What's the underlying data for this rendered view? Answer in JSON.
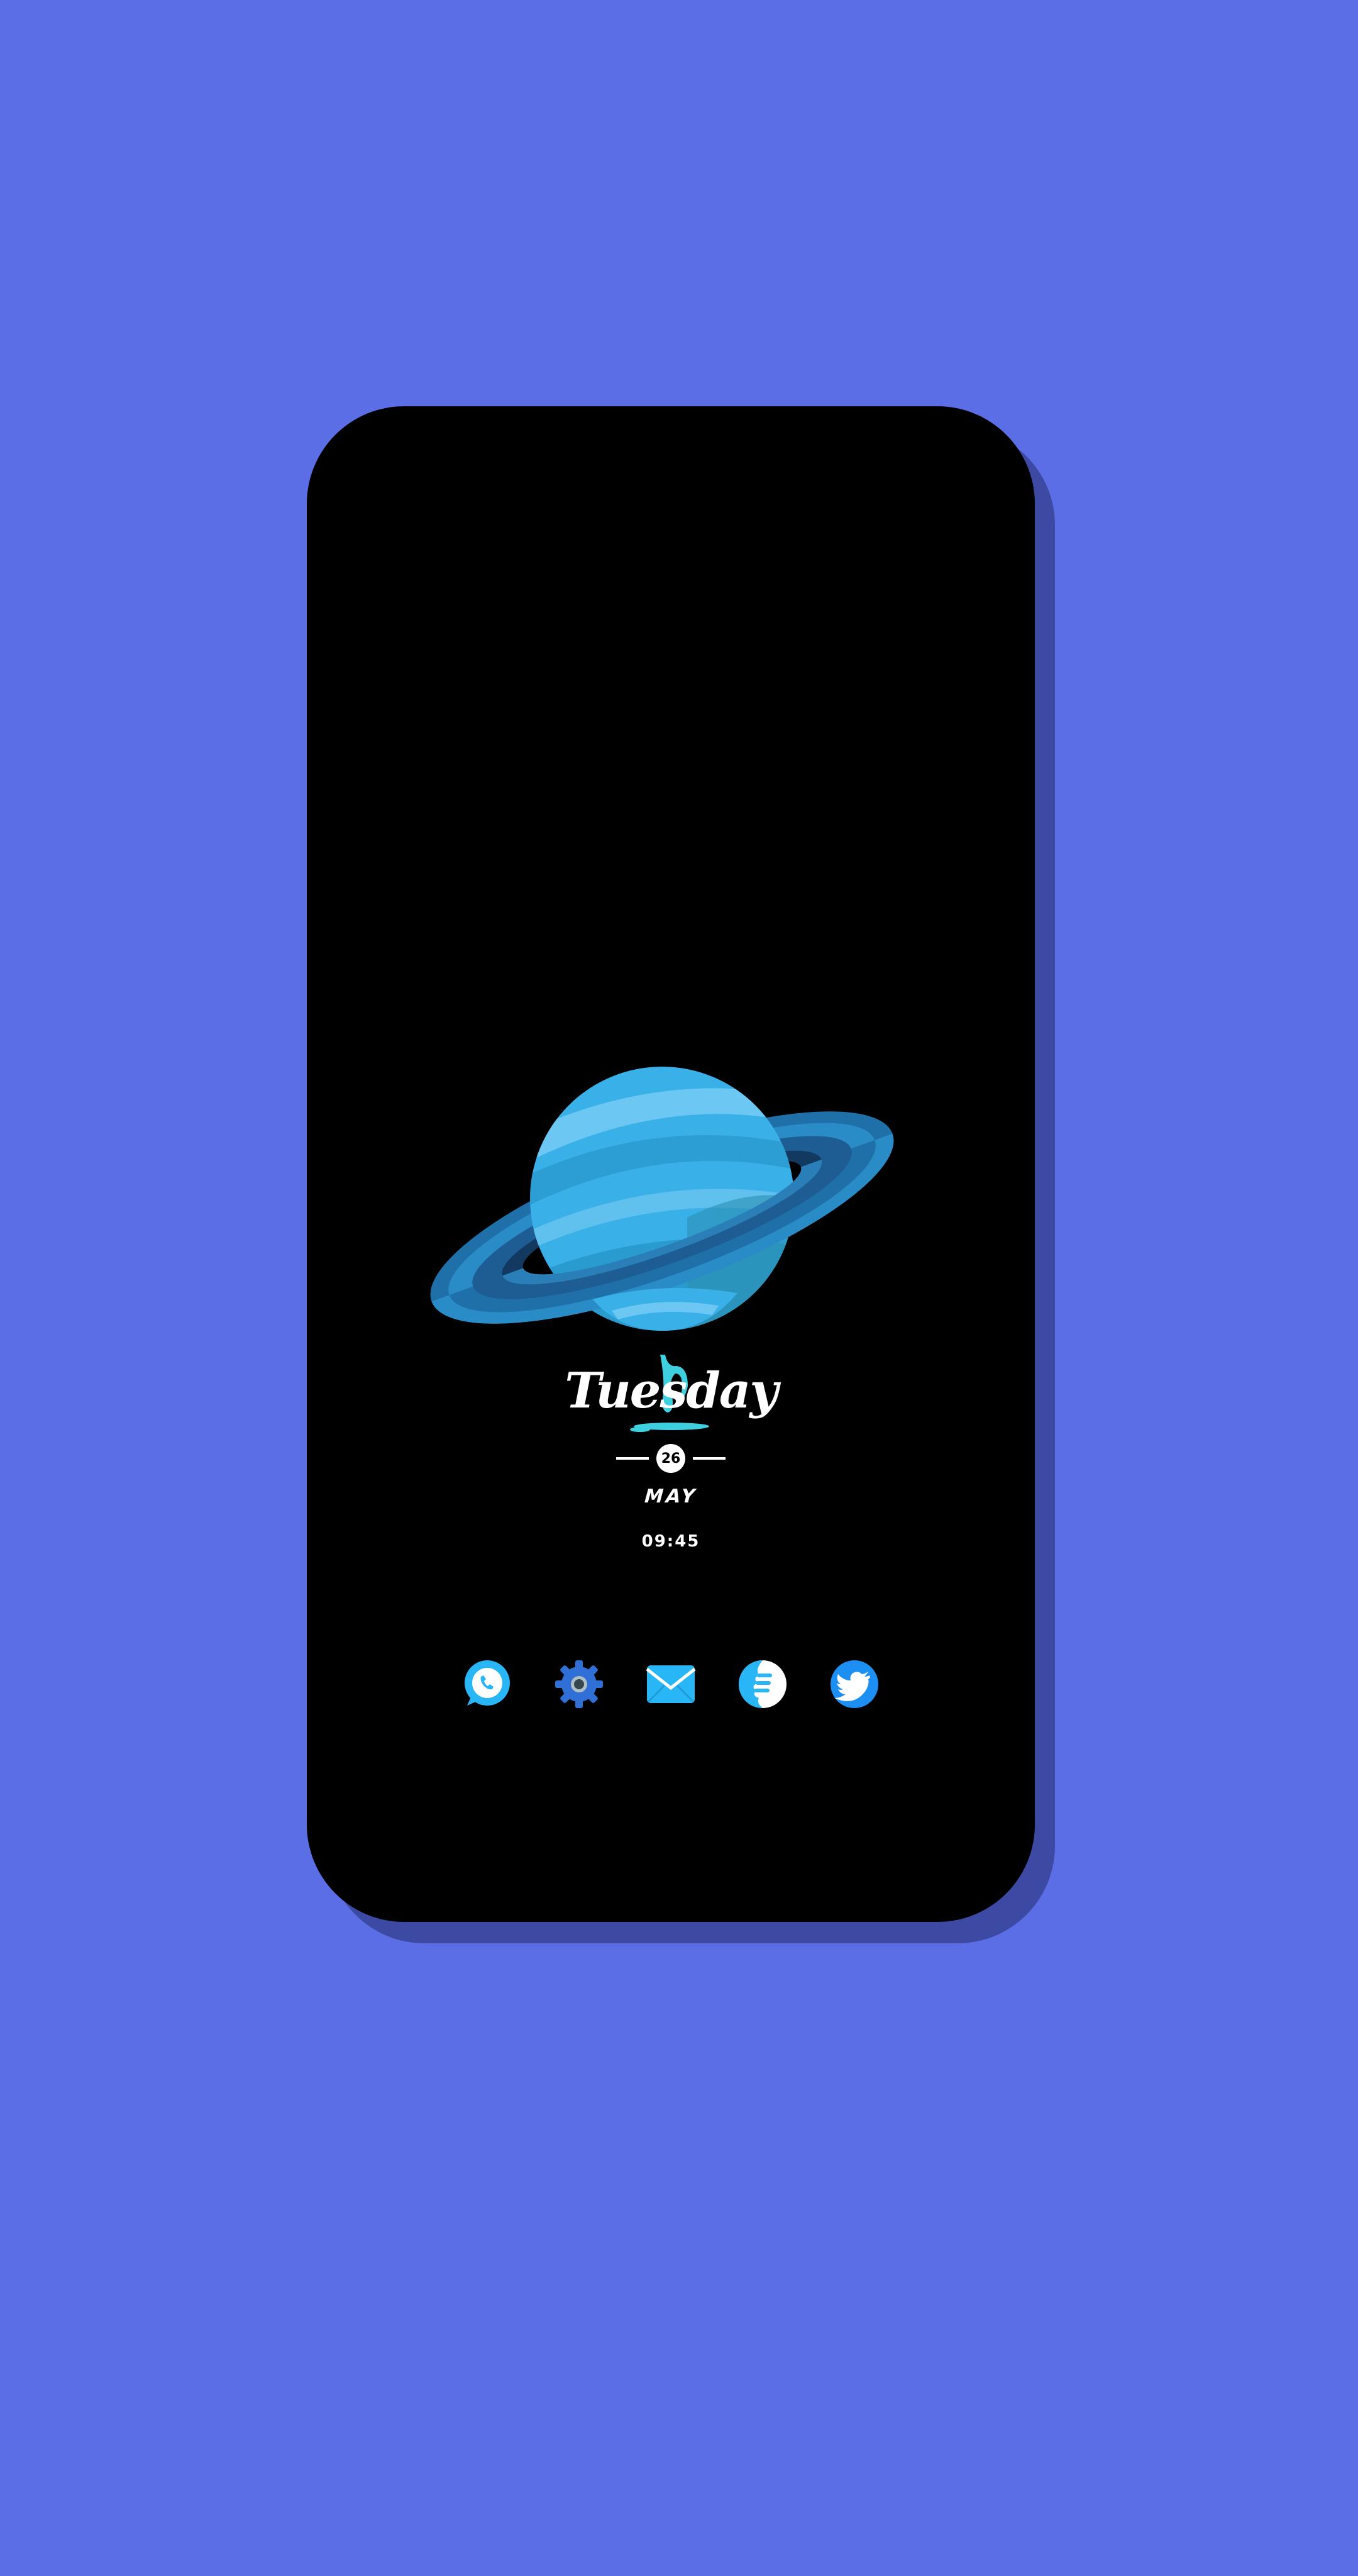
{
  "wallpaper": {
    "background_color": "#5b6ee6",
    "planet_color": "#3ab0e8",
    "ring_color": "#1f5f9a"
  },
  "clock": {
    "day": "Tuesday",
    "date": "26",
    "month": "MAY",
    "time": "09:45"
  },
  "dock": {
    "apps": [
      {
        "name": "phone",
        "icon": "phone-chat-icon"
      },
      {
        "name": "settings",
        "icon": "gear-icon"
      },
      {
        "name": "mail",
        "icon": "mail-icon"
      },
      {
        "name": "browser",
        "icon": "browser-icon"
      },
      {
        "name": "twitter",
        "icon": "twitter-bird-icon"
      }
    ]
  }
}
